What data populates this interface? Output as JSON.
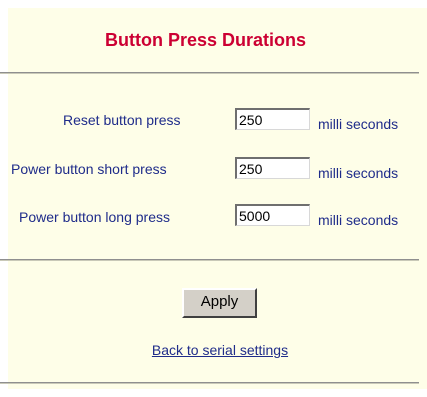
{
  "page": {
    "title": "Button Press Durations"
  },
  "settings": [
    {
      "label": "Reset button press",
      "value": "250",
      "unit": "milli seconds"
    },
    {
      "label": "Power button short press",
      "value": "250",
      "unit": "milli seconds"
    },
    {
      "label": "Power button long press",
      "value": "5000",
      "unit": "milli seconds"
    }
  ],
  "actions": {
    "apply_label": "Apply",
    "back_link_label": "Back to serial settings"
  },
  "colors": {
    "title": "#cc0033",
    "text": "#1f2c8a",
    "panel_background": "#fefee8",
    "button_face": "#d4d0c8"
  }
}
